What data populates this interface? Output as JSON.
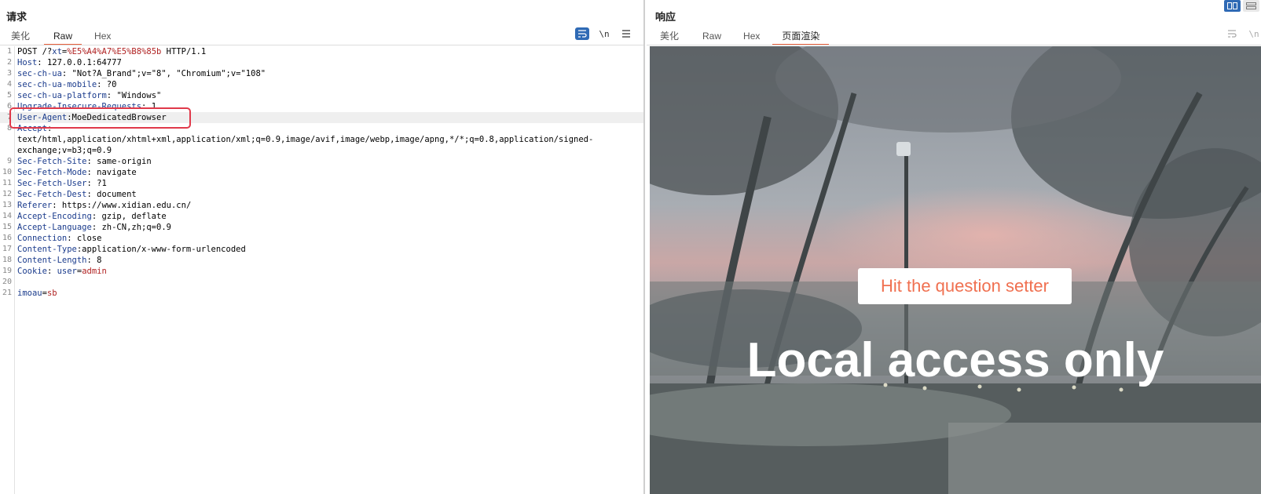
{
  "request": {
    "title": "请求",
    "tabs": [
      "美化",
      "Raw",
      "Hex"
    ],
    "active_tab": "Raw",
    "tools": {
      "wrap_icon": "wrap-lines-icon",
      "newline_label": "\\n",
      "menu_icon": "hamburger-menu-icon"
    },
    "lines": [
      {
        "n": "1",
        "parts": [
          [
            "plain",
            "POST /?"
          ],
          [
            "hdr",
            "xt"
          ],
          [
            "plain",
            "="
          ],
          [
            "url",
            "%E5%A4%A7%E5%B8%85b"
          ],
          [
            "plain",
            " HTTP/1.1"
          ]
        ]
      },
      {
        "n": "2",
        "parts": [
          [
            "hdr",
            "Host"
          ],
          [
            "plain",
            ": 127.0.0.1:64777"
          ]
        ]
      },
      {
        "n": "3",
        "parts": [
          [
            "hdr",
            "sec-ch-ua"
          ],
          [
            "plain",
            ": \"Not?A_Brand\";v=\"8\", \"Chromium\";v=\"108\""
          ]
        ]
      },
      {
        "n": "4",
        "parts": [
          [
            "hdr",
            "sec-ch-ua-mobile"
          ],
          [
            "plain",
            ": ?0"
          ]
        ]
      },
      {
        "n": "5",
        "parts": [
          [
            "hdr",
            "sec-ch-ua-platform"
          ],
          [
            "plain",
            ": \"Windows\""
          ]
        ]
      },
      {
        "n": "6",
        "parts": [
          [
            "hdr",
            "Upgrade-Insecure-Requests"
          ],
          [
            "plain",
            ": 1"
          ]
        ]
      },
      {
        "n": "7",
        "parts": [
          [
            "hdr",
            "User-Agent"
          ],
          [
            "plain",
            ":MoeDedicatedBrowser"
          ]
        ]
      },
      {
        "n": "8",
        "parts": [
          [
            "hdr",
            "Accept"
          ],
          [
            "plain",
            ":\ntext/html,application/xhtml+xml,application/xml;q=0.9,image/avif,image/webp,image/apng,*/*;q=0.8,application/signed-exchange;v=b3;q=0.9"
          ]
        ]
      },
      {
        "n": "9",
        "parts": [
          [
            "hdr",
            "Sec-Fetch-Site"
          ],
          [
            "plain",
            ": same-origin"
          ]
        ]
      },
      {
        "n": "10",
        "parts": [
          [
            "hdr",
            "Sec-Fetch-Mode"
          ],
          [
            "plain",
            ": navigate"
          ]
        ]
      },
      {
        "n": "11",
        "parts": [
          [
            "hdr",
            "Sec-Fetch-User"
          ],
          [
            "plain",
            ": ?1"
          ]
        ]
      },
      {
        "n": "12",
        "parts": [
          [
            "hdr",
            "Sec-Fetch-Dest"
          ],
          [
            "plain",
            ": document"
          ]
        ]
      },
      {
        "n": "13",
        "parts": [
          [
            "hdr",
            "Referer"
          ],
          [
            "plain",
            ": https://www.xidian.edu.cn/"
          ]
        ]
      },
      {
        "n": "14",
        "parts": [
          [
            "hdr",
            "Accept-Encoding"
          ],
          [
            "plain",
            ": gzip, deflate"
          ]
        ]
      },
      {
        "n": "15",
        "parts": [
          [
            "hdr",
            "Accept-Language"
          ],
          [
            "plain",
            ": zh-CN,zh;q=0.9"
          ]
        ]
      },
      {
        "n": "16",
        "parts": [
          [
            "hdr",
            "Connection"
          ],
          [
            "plain",
            ": close"
          ]
        ]
      },
      {
        "n": "17",
        "parts": [
          [
            "hdr",
            "Content-Type"
          ],
          [
            "plain",
            ":application/x-www-form-urlencoded"
          ]
        ]
      },
      {
        "n": "18",
        "parts": [
          [
            "hdr",
            "Content-Length"
          ],
          [
            "plain",
            ": 8"
          ]
        ]
      },
      {
        "n": "19",
        "parts": [
          [
            "hdr",
            "Cookie"
          ],
          [
            "plain",
            ": "
          ],
          [
            "hdr",
            "user"
          ],
          [
            "plain",
            "="
          ],
          [
            "cookie",
            "admin"
          ]
        ]
      },
      {
        "n": "20",
        "parts": []
      },
      {
        "n": "21",
        "parts": [
          [
            "hdr",
            "imoau"
          ],
          [
            "plain",
            "="
          ],
          [
            "cookie",
            "sb"
          ]
        ]
      }
    ]
  },
  "response": {
    "title": "响应",
    "tabs": [
      "美化",
      "Raw",
      "Hex",
      "页面渲染"
    ],
    "active_tab": "页面渲染",
    "tools": {
      "wrap_icon": "wrap-lines-icon",
      "newline_label": "\\n"
    },
    "render": {
      "button_text": "Hit the question setter",
      "headline": "Local access only"
    }
  },
  "colors": {
    "accent_tab": "#e8603c",
    "toggle_blue": "#2f6ab5",
    "highlight_box": "#e0394a"
  }
}
